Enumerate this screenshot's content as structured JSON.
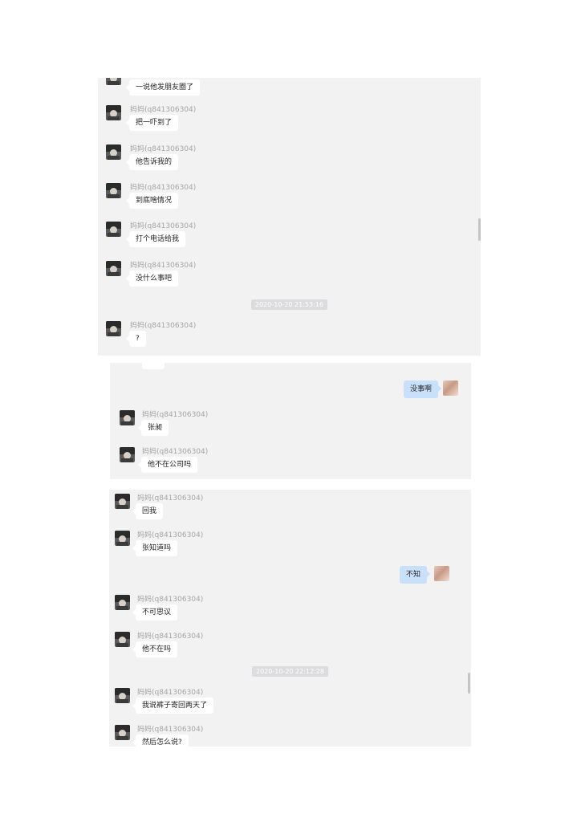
{
  "screenshot_1": {
    "top_cut_message": "一说他发朋友圈了",
    "messages": [
      {
        "sender": "妈妈(q841306304)",
        "text": "把一吓到了"
      },
      {
        "sender": "妈妈(q841306304)",
        "text": "他告诉我的"
      },
      {
        "sender": "妈妈(q841306304)",
        "text": "到底啥情况"
      },
      {
        "sender": "妈妈(q841306304)",
        "text": "打个电话给我"
      },
      {
        "sender": "妈妈(q841306304)",
        "text": "没什么事吧"
      }
    ],
    "timestamp": "2020-10-20 21:53:16",
    "after_timestamp": {
      "sender": "妈妈(q841306304)",
      "text": "?"
    }
  },
  "screenshot_2": {
    "top_cut_message": "?",
    "my_message": "没事啊",
    "messages": [
      {
        "sender": "妈妈(q841306304)",
        "text": "张昶"
      },
      {
        "sender": "妈妈(q841306304)",
        "text": "他不在公司吗"
      }
    ]
  },
  "screenshot_3": {
    "messages_before": [
      {
        "sender": "妈妈(q841306304)",
        "text": "回我"
      },
      {
        "sender": "妈妈(q841306304)",
        "text": "张知道吗"
      }
    ],
    "my_message": "不知",
    "messages_after": [
      {
        "sender": "妈妈(q841306304)",
        "text": "不可思议"
      },
      {
        "sender": "妈妈(q841306304)",
        "text": "他不在吗"
      }
    ],
    "timestamp": "2020-10-20 22:12:28",
    "messages_final": [
      {
        "sender": "妈妈(q841306304)",
        "text": "我说裤子寄回两天了"
      },
      {
        "sender": "妈妈(q841306304)",
        "text": "然后怎么说?"
      }
    ]
  }
}
